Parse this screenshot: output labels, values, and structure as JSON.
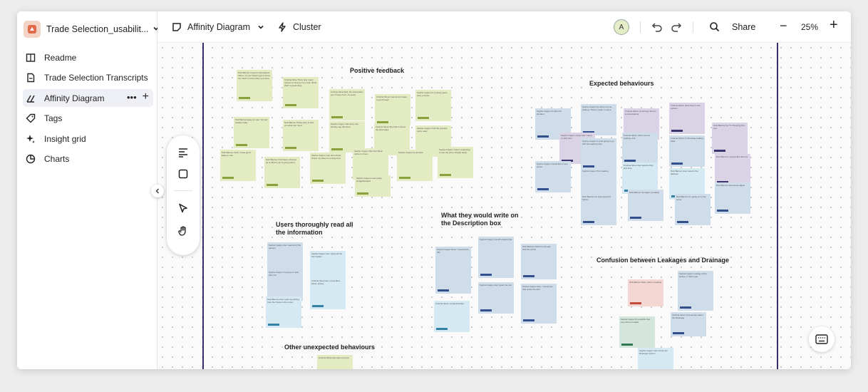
{
  "project": {
    "name": "Trade Selection_usabilit..."
  },
  "sidebar": {
    "items": [
      {
        "label": "Readme",
        "icon": "book-icon"
      },
      {
        "label": "Trade Selection Transcripts",
        "icon": "document-icon"
      },
      {
        "label": "Affinity Diagram",
        "icon": "affinity-icon",
        "active": true
      },
      {
        "label": "Tags",
        "icon": "tag-icon"
      },
      {
        "label": "Insight grid",
        "icon": "sparkle-icon"
      },
      {
        "label": "Charts",
        "icon": "pie-chart-icon"
      }
    ],
    "more": "•••",
    "add": "+"
  },
  "toolbar": {
    "view_label": "Affinity Diagram",
    "cluster_label": "Cluster",
    "avatar_initial": "A",
    "share_label": "Share",
    "zoom_out": "−",
    "zoom_level": "25%",
    "zoom_in": "+"
  },
  "headings": {
    "positive": "Positive feedback",
    "expected": "Expected behaviours",
    "thoroughly": "Users thoroughly read all the information",
    "description": "What they would write on the Description box",
    "confusion": "Confusion between Leakages and Drainage",
    "other": "Other unexpected behaviours"
  },
  "notes": {
    "n1": "Nick Barnes It seems transparent rather; so you haven't got to know too much on how when you were",
    "n2": "Cristina Silva There was many options to choose from and I think that's a good thing",
    "n3": "Cristina Silva Well, the information you choose from, it's good",
    "n4": "Cristina Silva It was kind of easy to go through",
    "n5": "Sophie Capps It's a pretty good, easy process",
    "n6": "Nick Barnes Easy for use. Normal tweaks really",
    "n7": "Nick Barnes Pretty easy to find out what you need",
    "n8": "Sophie Capps I like that I can directly see the price",
    "n9": "Cristina Silva I like that it shows the float steps",
    "n10": "Sophie Capps I find the process pretty easy",
    "n11": "Nick Barnes Yeah, it was good. Easy to use",
    "n12": "Nick Barnes It did seem obvious as to where you're going with it",
    "n13": "Sophie Capps I just don't know where my issue is coming from",
    "n14": "Sophie Capps I like that 'Book online' is there",
    "n15": "Sophie Capps It's all clear",
    "n16": "Sophie Capps I wasn't expecting to see the price straight away",
    "n17": "Sophie Capps It was pretty straightforward",
    "e1": "Sophie Capps I'd click this plumber",
    "e2": "Sophie Capps So there's some leaking. There's water in same",
    "e3": "Cristina Silva I would say 'there's a toilet leaking'",
    "e4": "Cristina Silva I think there's two options",
    "e5": "Sophie Capps I know that I need to click here",
    "e6": "Sophie Capps I'm just going to go with the leaking toilet",
    "e7": "Cristina Silva I think now it's 'leaking sink'",
    "e8": "Cristina Silva I'm choosing 'leaking toilet'",
    "e9": "Nick Barnes So I'm choosing this one",
    "e10": "Nick Barnes I would click this box",
    "e11": "Sophie Capps I would like to see prices",
    "e12": "Sophie Capps Then leaking",
    "e13": "Cristina Silva User selects date and time",
    "e14": "Nick Barnes User selects the address",
    "e15": "Nick Barnes Sometimes again",
    "e16": "Nick Barnes I'm assuming this button",
    "e17": "Nick Barnes So again, probably",
    "e18": "Nick Barnes I'm going to try the same",
    "t1": "Sophie Capps User read all of the options",
    "t2": "Sophie Capps User reads all the information",
    "t3": "Sophie Capps I'm going to read them all",
    "t4": "Cristina Silva Now it describes what I shows",
    "t5": "Nick Barnes User read everything from the Trade to the notes",
    "w1": "Sophie Capps Since I would write this",
    "w2": "Sophie Capps I would explain that",
    "w3": "Sophie Capps User typed the text",
    "w4": "Nick Barnes Click the tab and click the photo",
    "w5": "Sophie Capps Here, I would put that under the sink",
    "w6": "Sophie Capps Cause just some note about the type of ...",
    "w7": "Nick Barnes I'd put the photo",
    "w8": "Cristina Silva I would describe",
    "c1": "Nick Barnes Well, water is leaking",
    "c2": "Sophie Capps Looking at the picture, if there was",
    "c3": "Cristina Silva I just wonder about the Drainage",
    "c4": "Sophie Capps It's possible that user did not realize",
    "c5": "Sophie Capps User chose the Drainage section",
    "o1": "Cristina Silva User was not sure"
  }
}
